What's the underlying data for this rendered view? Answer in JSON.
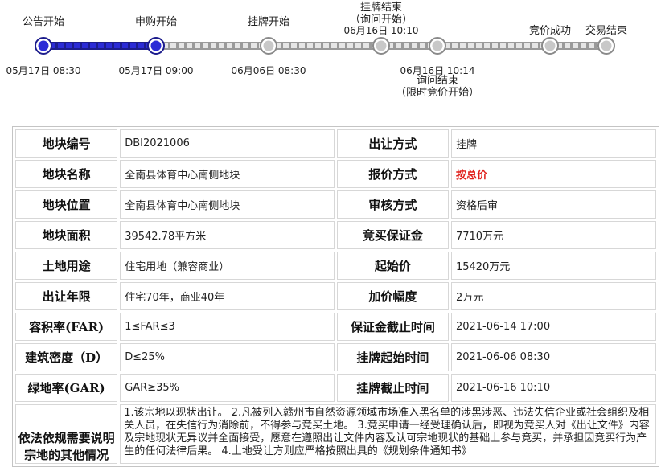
{
  "timeline": {
    "steps": [
      {
        "label": "公告开始",
        "date": "05月17日  08:30",
        "status": "done"
      },
      {
        "label": "申购开始",
        "date": "05月17日  09:00",
        "status": "done"
      },
      {
        "label": "挂牌开始",
        "date": "06月06日  08:30",
        "status": "pending"
      },
      {
        "label": "挂牌结束",
        "label2": "（询问开始）",
        "date": "06月16日  10:10",
        "status": "pending"
      },
      {
        "label": "询问结束",
        "label2": "（限时竞价开始）",
        "date": "06月16日  10:14",
        "status": "pending"
      },
      {
        "label": "竞价成功",
        "status": "pending"
      },
      {
        "label": "交易结束",
        "status": "pending"
      }
    ],
    "colors": {
      "done_fill": "#2b2bd6",
      "done_track": "#1c1c8c",
      "pending_fill": "#c8c8c8",
      "pending_track": "#9a9a9a"
    }
  },
  "table": {
    "rows": [
      {
        "l1": "地块编号",
        "v1": "DBI2021006",
        "l2": "出让方式",
        "v2": "挂牌"
      },
      {
        "l1": "地块名称",
        "v1": "全南县体育中心南侧地块",
        "l2": "报价方式",
        "v2": "按总价"
      },
      {
        "l1": "地块位置",
        "v1": "全南县体育中心南侧地块",
        "l2": "审核方式",
        "v2": "资格后审"
      },
      {
        "l1": "地块面积",
        "v1": "39542.78平方米",
        "l2": "竞买保证金",
        "v2": "7710万元"
      },
      {
        "l1": "土地用途",
        "v1": "住宅用地（兼容商业）",
        "l2": "起始价",
        "v2": "15420万元"
      },
      {
        "l1": "出让年限",
        "v1": "住宅70年，商业40年",
        "l2": "加价幅度",
        "v2": "2万元"
      },
      {
        "l1": "容积率(FAR)",
        "v1": "1≤FAR≤3",
        "l2": "保证金截止时间",
        "v2": "2021-06-14 17:00"
      },
      {
        "l1": "建筑密度（D）",
        "v1": "D≤25%",
        "l2": "挂牌起始时间",
        "v2": "2021-06-06 08:30"
      },
      {
        "l1": "绿地率(GAR)",
        "v1": "GAR≥35%",
        "l2": "挂牌截止时间",
        "v2": "2021-06-16 10:10"
      }
    ],
    "notes_label": "依法依规需要说明宗地的其他情况",
    "notes_text": "1.该宗地以现状出让。 2.凡被列入赣州市自然资源领域市场准入黑名单的涉黑涉恶、违法失信企业或社会组织及相关人员，在失信行为消除前，不得参与竞买土地。 3.竞买申请一经受理确认后，即视为竞买人对《出让文件》内容及宗地现状无异议并全面接受，愿意在遵照出让文件内容及认可宗地现状的基础上参与竞买，并承担因竞买行为产生的任何法律后果。 4.土地受让方则应严格按照出具的《规划条件通知书》"
  }
}
